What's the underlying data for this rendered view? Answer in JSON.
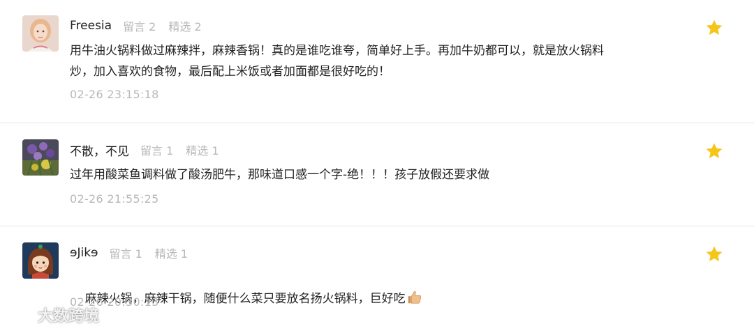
{
  "comments": [
    {
      "name": "Freesia",
      "reply_label": "留言 2",
      "featured_label": "精选 2",
      "text": "用牛油火锅料做过麻辣拌，麻辣香锅！真的是谁吃谁夸，简单好上手。再加牛奶都可以，就是放火锅料\n炒，加入喜欢的食物，最后配上米饭或者加面都是很好吃的！",
      "time": "02-26 23:15:18",
      "starred": true
    },
    {
      "name": "不散，不见",
      "reply_label": "留言 1",
      "featured_label": "精选 1",
      "text": "过年用酸菜鱼调料做了酸汤肥牛，那味道口感一个字-绝！！！孩子放假还要求做",
      "time": "02-26 21:55:25",
      "starred": true
    },
    {
      "name": "ɘJikɘ",
      "reply_label": "留言 1",
      "featured_label": "精选 1",
      "text": "麻辣火锅，麻辣干锅，随便什么菜只要放名扬火锅料，巨好吃",
      "time": "02-26 20:30:13",
      "starred": true
    }
  ],
  "watermark": "大数跨境",
  "colors": {
    "star": "#f5c518",
    "muted_text": "#b8b8b8",
    "main_text": "#222222",
    "divider": "#e6e6e6"
  },
  "icons": [
    "star-icon",
    "thumbs-up-icon",
    "watermark-logo-icon"
  ]
}
